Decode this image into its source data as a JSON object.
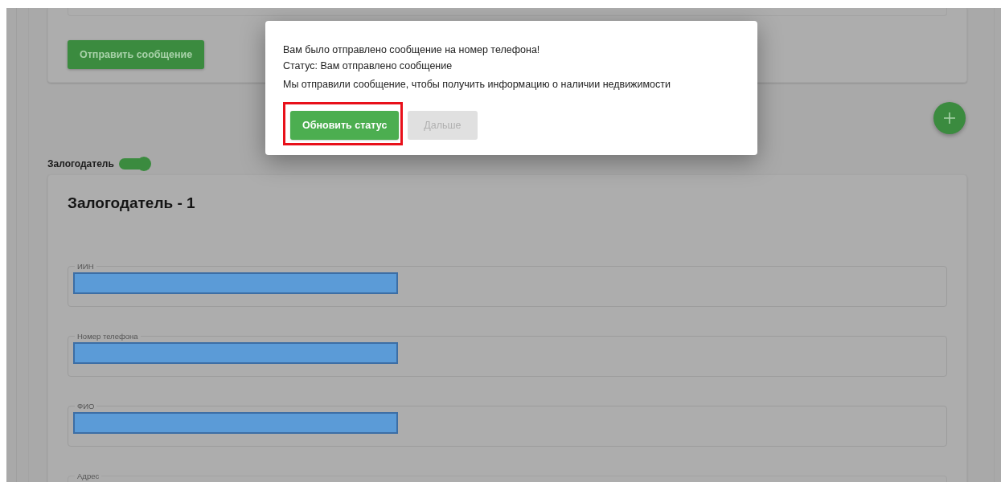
{
  "top_card": {
    "button": "Отправить сообщение"
  },
  "section": {
    "label": "Залогодатель",
    "toggle_on": true
  },
  "card": {
    "title": "Залогодатель - 1",
    "fields": [
      {
        "label": "ИИН",
        "redacted": true
      },
      {
        "label": "Номер телефона",
        "redacted": true
      },
      {
        "label": "ФИО",
        "redacted": true
      },
      {
        "label": "Адрес"
      }
    ]
  },
  "dialog": {
    "lines": [
      "Вам было отправлено сообщение на номер телефона!",
      "Статус: Вам отправлено сообщение",
      "Мы отправили сообщение, чтобы получить информацию о наличии недвижимости"
    ],
    "buttons": [
      {
        "label": "Обновить статус",
        "disabled": false,
        "highlighted": true
      },
      {
        "label": "Дальше",
        "disabled": true,
        "highlighted": false
      }
    ]
  }
}
